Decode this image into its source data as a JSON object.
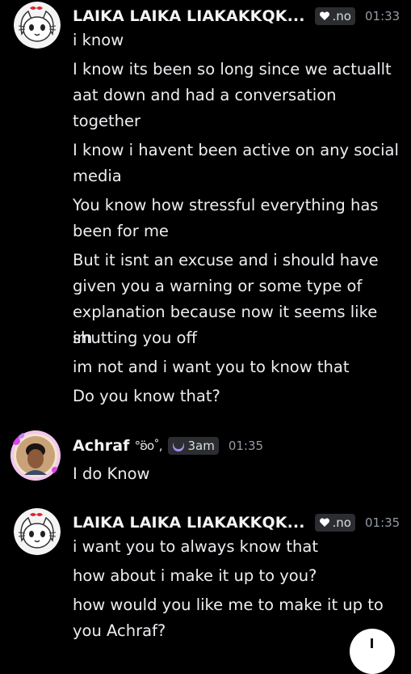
{
  "messages": [
    {
      "username": "LAIKA LAIKA LIAKAKKQK...",
      "tag": ".no",
      "tag_icon": "heart-icon",
      "time": "01:33",
      "lines": [
        "i know",
        "I know its been so long since we actuallt",
        "aat down and had a conversation",
        "together",
        "I know i havent been active on any social",
        "media",
        "You know how stressful everything has",
        "been for me",
        "But it isnt an excuse and i should have",
        "given you a warning or some type of",
        "explanation because now it seems like im",
        "shutting you off",
        "im not and i want you to know that",
        "Do you know that?"
      ]
    },
    {
      "username": "Achraf",
      "username_deco": "°ʚ̈o˚,",
      "tag": "3am",
      "tag_icon": "moon-icon",
      "time": "01:35",
      "lines": [
        "I do Know"
      ]
    },
    {
      "username": "LAIKA LAIKA LIAKAKKQK...",
      "tag": ".no",
      "tag_icon": "heart-icon",
      "time": "01:35",
      "lines": [
        "i want you to always know that",
        "how about i make it up to you?",
        "how would you like me to make it up to",
        "you Achraf?"
      ]
    }
  ],
  "colors": {
    "background": "#000000",
    "username": "#f2f3f5",
    "message_text": "#eceef1",
    "timestamp": "#949ba4",
    "tag_bg": "#2b2d31",
    "moon_accent": "#a78bfa"
  }
}
